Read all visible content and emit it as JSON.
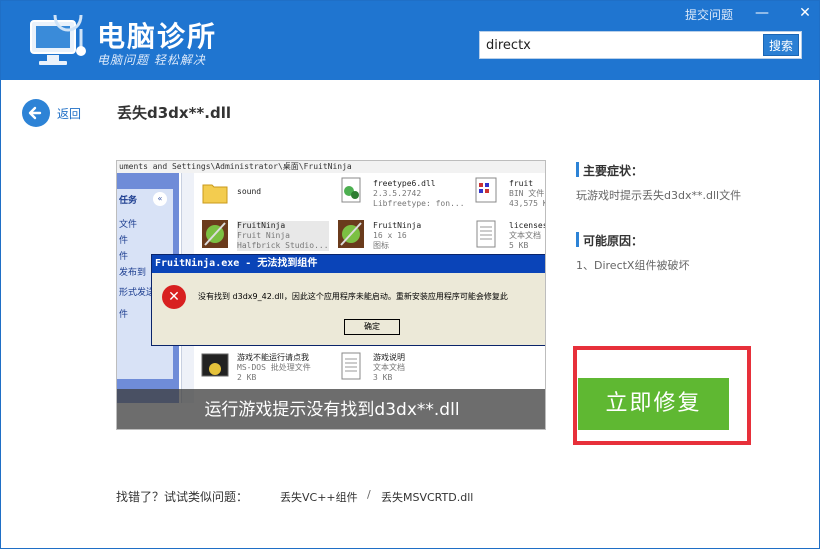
{
  "header": {
    "app_title": "电脑诊所",
    "app_subtitle": "电脑问题 轻松解决",
    "report_link": "提交问题",
    "minimize": "—",
    "close": "✕",
    "search": {
      "value": "directx",
      "button": "搜索"
    }
  },
  "nav": {
    "back_label": "返回"
  },
  "issue": {
    "title": "丢失d3dx**.dll"
  },
  "screenshot": {
    "address": "uments and Settings\\Administrator\\桌面\\FruitNinja",
    "left_panel": {
      "title": "任务",
      "collapse": "«",
      "items": [
        "文件",
        "件",
        "件",
        "发布到",
        "形式发送",
        "件"
      ]
    },
    "files": [
      {
        "name": "sound",
        "line2": "",
        "line3": ""
      },
      {
        "name": "freetype6.dll",
        "line2": "2.3.5.2742",
        "line3": "Libfreetype: fon..."
      },
      {
        "name": "fruit",
        "line2": "BIN 文件",
        "line3": "43,575 K"
      },
      {
        "name": "FruitNinja",
        "line2": "Fruit Ninja",
        "line3": "Halfbrick Studio..."
      },
      {
        "name": "FruitNinja",
        "line2": "16 x 16",
        "line3": "图标"
      },
      {
        "name": "licenses",
        "line2": "文本文档",
        "line3": "5 KB"
      },
      {
        "name": "游戏不能运行请点我",
        "line2": "MS-DOS 批处理文件",
        "line3": "2 KB"
      },
      {
        "name": "游戏说明",
        "line2": "文本文档",
        "line3": "3 KB"
      }
    ],
    "dialog": {
      "title": "FruitNinja.exe - 无法找到组件",
      "message": "没有找到 d3dx9_42.dll，因此这个应用程序未能启动。重新安装应用程序可能会修复此",
      "ok": "确定"
    },
    "caption": "运行游戏提示没有找到d3dx**.dll"
  },
  "details": {
    "symptom_title": "主要症状：",
    "symptom_text": "玩游戏时提示丢失d3dx**.dll文件",
    "cause_title": "可能原因：",
    "cause_text": "1、DirectX组件被破坏"
  },
  "fix_button": "立即修复",
  "footer": {
    "label": "找错了？试试类似问题：",
    "links": [
      "丢失VC++组件",
      "丢失MSVCRTD.dll"
    ],
    "separator": "/"
  },
  "colors": {
    "header_blue": "#1f75d0",
    "accent_blue": "#2d83d6",
    "fix_green": "#5fb832",
    "highlight_red": "#e7303a"
  }
}
